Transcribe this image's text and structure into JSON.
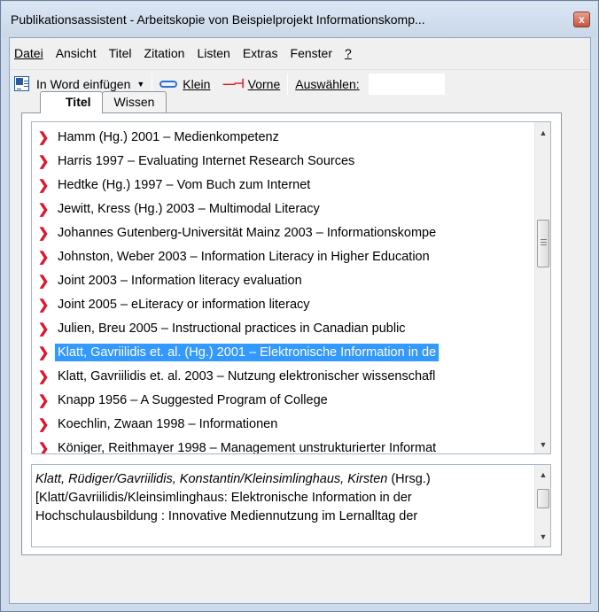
{
  "window": {
    "title": "Publikationsassistent - Arbeitskopie von Beispielprojekt Informationskomp...",
    "close_glyph": "x"
  },
  "menu": [
    {
      "label": "Datei"
    },
    {
      "label": "Ansicht"
    },
    {
      "label": "Titel"
    },
    {
      "label": "Zitation"
    },
    {
      "label": "Listen"
    },
    {
      "label": "Extras"
    },
    {
      "label": "Fenster"
    },
    {
      "label": "?"
    }
  ],
  "toolbar": {
    "insert_word": "In Word einfügen",
    "klein": "Klein",
    "vorne": "Vorne",
    "auswaehlen": "Auswählen:",
    "search_value": ""
  },
  "tabs": [
    {
      "label": "Titel",
      "active": true
    },
    {
      "label": "Wissen",
      "active": false
    }
  ],
  "list": {
    "bullet_glyph": "❯",
    "items": [
      "Hamm (Hg.) 2001 – Medienkompetenz",
      "Harris 1997 – Evaluating Internet Research Sources",
      "Hedtke (Hg.) 1997 – Vom Buch zum Internet",
      "Jewitt, Kress (Hg.) 2003 – Multimodal Literacy",
      "Johannes Gutenberg-Universität Mainz 2003 – Informationskompe",
      "Johnston, Weber 2003 – Information Literacy in Higher Education",
      "Joint 2003 – Information literacy evaluation",
      "Joint 2005 – eLiteracy or information literacy",
      "Julien, Breu 2005 – Instructional practices in Canadian public",
      "Klatt, Gavriilidis et. al. (Hg.) 2001 – Elektronische Information in de",
      "Klatt, Gavriilidis et. al. 2003 – Nutzung elektronischer wissenschafl",
      "Knapp 1956 – A Suggested Program of College",
      "Koechlin, Zwaan 1998 – Informationen",
      "Königer, Reithmayer 1998 – Management unstrukturierter Informat"
    ],
    "selected_index": 9
  },
  "detail": {
    "authors": "Klatt, Rüdiger/Gavriilidis, Konstantin/Kleinsimlinghaus, Kirsten",
    "authors_suffix": " (Hrsg.)",
    "line2": "[Klatt/Gavriilidis/Kleinsimlinghaus: Elektronische Information in der",
    "line3": "Hochschulausbildung : Innovative Mediennutzung im Lernalltag der"
  },
  "colors": {
    "selection": "#3399ff",
    "bullet": "#e0142c",
    "chrome": "#cfdbea"
  }
}
